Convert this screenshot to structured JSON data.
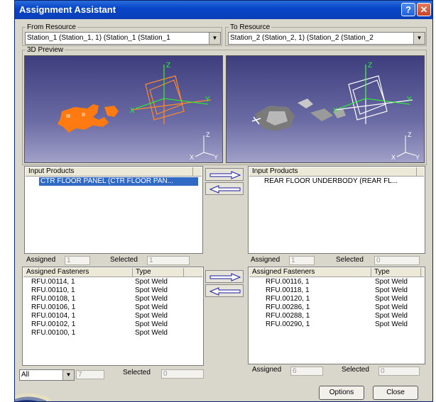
{
  "window": {
    "title": "Assignment Assistant",
    "help_glyph": "?",
    "close_glyph": "✕"
  },
  "from_resource": {
    "label": "From Resource",
    "value": "Station_1 (Station_1, 1) (Station_1 (Station_1"
  },
  "to_resource": {
    "label": "To Resource",
    "value": "Station_2 (Station_2, 1) (Station_2 (Station_2"
  },
  "preview": {
    "label": "3D Preview"
  },
  "left": {
    "products_header": "Input Products",
    "products": [
      "CTR FLOOR PANEL (CTR FLOOR PAN..."
    ],
    "assigned_label": "Assigned",
    "assigned_value": "1",
    "selected_label": "Selected",
    "selected_value": "1",
    "fasteners_header": "Assigned Fasteners",
    "type_header": "Type",
    "fasteners": [
      {
        "name": "RFU.00114, 1",
        "type": "Spot Weld"
      },
      {
        "name": "RFU.00110, 1",
        "type": "Spot Weld"
      },
      {
        "name": "RFU.00108, 1",
        "type": "Spot Weld"
      },
      {
        "name": "RFU.00106, 1",
        "type": "Spot Weld"
      },
      {
        "name": "RFU.00104, 1",
        "type": "Spot Weld"
      },
      {
        "name": "RFU.00102, 1",
        "type": "Spot Weld"
      },
      {
        "name": "RFU.00100, 1",
        "type": "Spot Weld"
      }
    ],
    "filter_value": "All",
    "filter_count": "7",
    "fast_selected_label": "Selected",
    "fast_selected_value": "0"
  },
  "right": {
    "products_header": "Input Products",
    "products": [
      "REAR FLOOR UNDERBODY (REAR FL..."
    ],
    "assigned_label": "Assigned",
    "assigned_value": "1",
    "selected_label": "Selected",
    "selected_value": "0",
    "fasteners_header": "Assigned Fasteners",
    "type_header": "Type",
    "fasteners": [
      {
        "name": "RFU.00116, 1",
        "type": "Spot Weld"
      },
      {
        "name": "RFU.00118, 1",
        "type": "Spot Weld"
      },
      {
        "name": "RFU.00120, 1",
        "type": "Spot Weld"
      },
      {
        "name": "RFU.00286, 1",
        "type": "Spot Weld"
      },
      {
        "name": "RFU.00288, 1",
        "type": "Spot Weld"
      },
      {
        "name": "RFU.00290, 1",
        "type": "Spot Weld"
      }
    ],
    "fast_assigned_label": "Assigned",
    "fast_assigned_value": "6",
    "fast_selected_label": "Selected",
    "fast_selected_value": "0"
  },
  "axis_labels": {
    "x": "X",
    "y": "Y",
    "z": "Z"
  },
  "buttons": {
    "options": "Options",
    "close": "Close"
  },
  "colors": {
    "titlebar": "#0846c8",
    "selection": "#316ac5",
    "part_orange": "#ff7a10",
    "frame_orange": "#ff8a2a",
    "dialog": "#d9d6cc"
  },
  "icons": [
    "help-icon",
    "close-icon",
    "arrow-right-icon",
    "arrow-left-icon",
    "dropdown-arrow-icon",
    "axis-triad-icon",
    "compass-icon"
  ]
}
